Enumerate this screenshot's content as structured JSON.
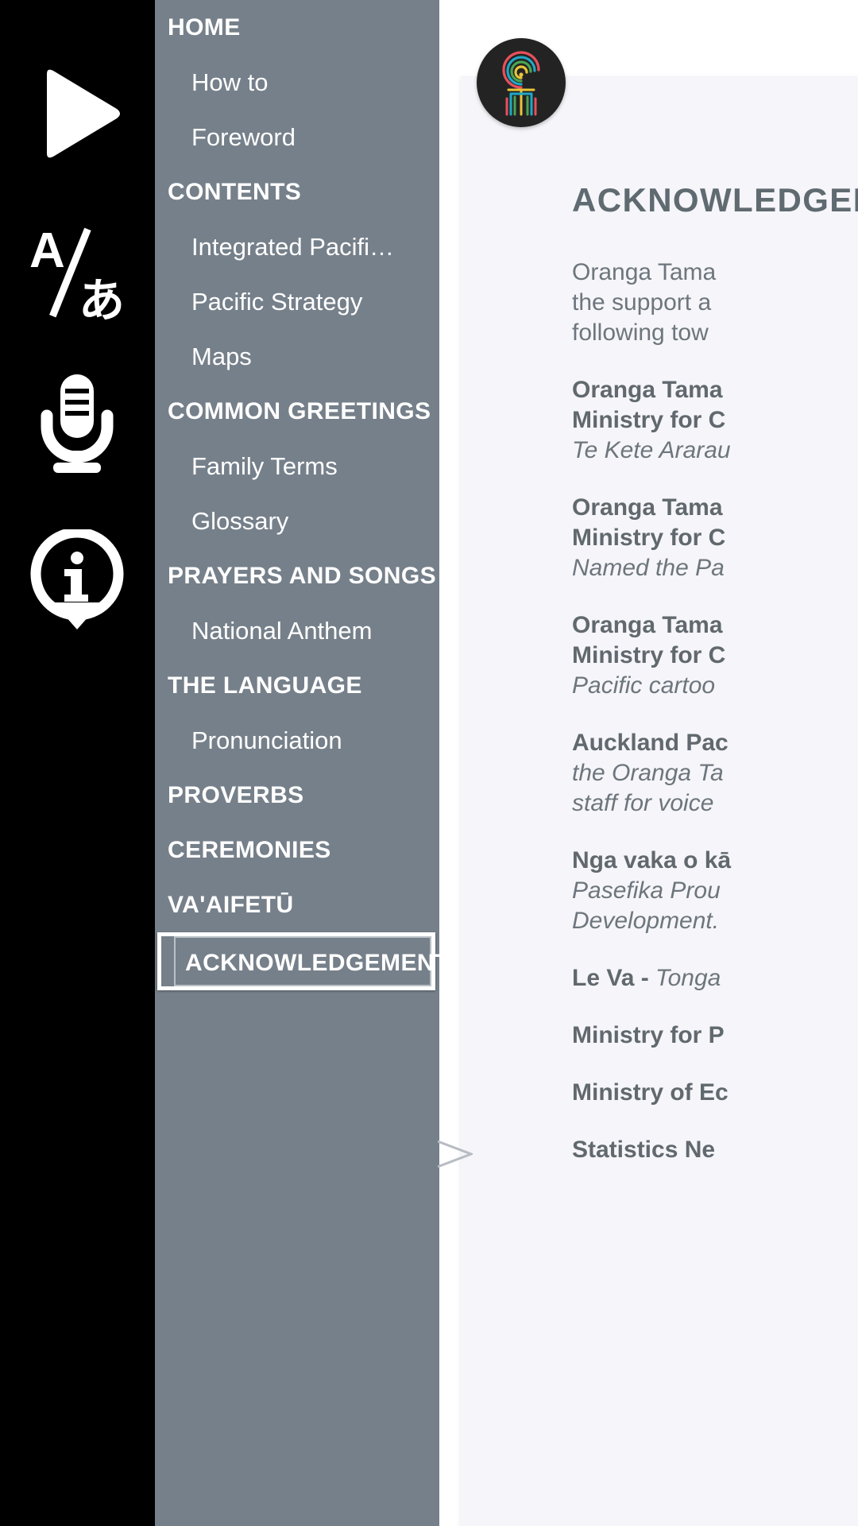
{
  "rail": {
    "icons": [
      {
        "name": "play-icon",
        "label": "Play"
      },
      {
        "name": "language-toggle-icon",
        "label": "A/あ"
      },
      {
        "name": "microphone-icon",
        "label": "Record"
      },
      {
        "name": "info-pin-icon",
        "label": "Info"
      }
    ]
  },
  "sidebar": {
    "background_color": "#76808a",
    "selected_item": "ACKNOWLEDGEMENTS",
    "items": [
      {
        "label": "HOME",
        "type": "section"
      },
      {
        "label": "How to",
        "type": "item"
      },
      {
        "label": "Foreword",
        "type": "item"
      },
      {
        "label": "CONTENTS",
        "type": "section"
      },
      {
        "label": "Integrated Pacific Cu…",
        "type": "item"
      },
      {
        "label": "Pacific Strategy",
        "type": "item"
      },
      {
        "label": "Maps",
        "type": "item"
      },
      {
        "label": "COMMON GREETINGS",
        "type": "section"
      },
      {
        "label": "Family Terms",
        "type": "item"
      },
      {
        "label": "Glossary",
        "type": "item"
      },
      {
        "label": "PRAYERS AND SONGS",
        "type": "section"
      },
      {
        "label": "National Anthem",
        "type": "item"
      },
      {
        "label": "THE LANGUAGE",
        "type": "section"
      },
      {
        "label": "Pronunciation",
        "type": "item"
      },
      {
        "label": "PROVERBS",
        "type": "section"
      },
      {
        "label": "CEREMONIES",
        "type": "section"
      },
      {
        "label": "VA'AIFETŪ",
        "type": "section"
      },
      {
        "label": "ACKNOWLEDGEMENTS",
        "type": "section",
        "selected": true
      }
    ]
  },
  "content": {
    "logo_alt": "koru-spiral-logo",
    "title": "ACKNOWLEDGEMENTS",
    "intro": [
      "Oranga Tama",
      "the support a",
      "following tow"
    ],
    "entries": [
      {
        "bold_lines": [
          "Oranga Tama",
          "Ministry for C"
        ],
        "italic_lines": [
          "Te Kete Ararau"
        ]
      },
      {
        "bold_lines": [
          "Oranga Tama",
          "Ministry for C"
        ],
        "italic_lines": [
          "Named the Pa"
        ]
      },
      {
        "bold_lines": [
          "Oranga Tama",
          "Ministry for C"
        ],
        "italic_lines": [
          "Pacific cartoo"
        ]
      },
      {
        "bold_lines": [
          "Auckland Pac"
        ],
        "italic_lines": [
          "the Oranga Ta",
          "staff for voice"
        ]
      },
      {
        "bold_lines": [
          "Nga vaka o kā"
        ],
        "italic_lines": [
          "Pasefika Prou",
          "Development."
        ]
      },
      {
        "mixed": true,
        "bold_prefix": "Le Va - ",
        "italic_rest": "Tonga"
      },
      {
        "bold_lines": [
          "Ministry for P"
        ],
        "italic_lines": []
      },
      {
        "bold_lines": [
          "Ministry of Ec"
        ],
        "italic_lines": []
      },
      {
        "bold_lines": [
          "Statistics Ne"
        ],
        "italic_lines": []
      }
    ]
  },
  "colors": {
    "rail_background": "#000000",
    "sidebar_background": "#76808a",
    "content_background": "#ffffff",
    "card_background": "#f5f5fa",
    "text_primary": "#ffffff",
    "doc_text": "#6d767c",
    "doc_heading": "#5f6b70"
  }
}
